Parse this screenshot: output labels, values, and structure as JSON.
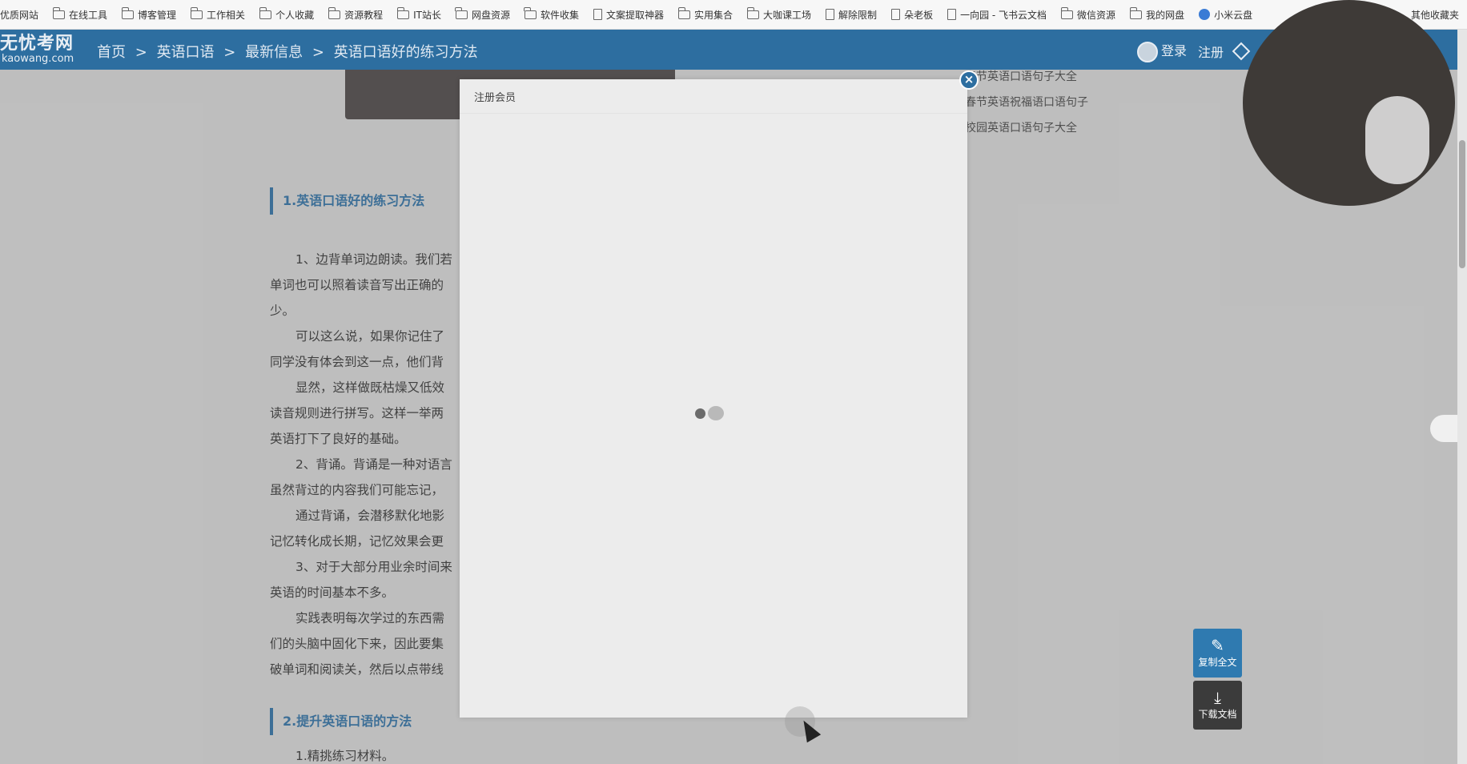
{
  "bookmarks": [
    {
      "label": "优质网站",
      "icon": "folder-icon"
    },
    {
      "label": "在线工具",
      "icon": "folder-icon"
    },
    {
      "label": "博客管理",
      "icon": "folder-icon"
    },
    {
      "label": "工作相关",
      "icon": "folder-icon"
    },
    {
      "label": "个人收藏",
      "icon": "folder-icon"
    },
    {
      "label": "资源教程",
      "icon": "folder-icon"
    },
    {
      "label": "IT站长",
      "icon": "folder-icon"
    },
    {
      "label": "网盘资源",
      "icon": "folder-icon"
    },
    {
      "label": "软件收集",
      "icon": "folder-icon"
    },
    {
      "label": "文案提取神器",
      "icon": "doc-icon"
    },
    {
      "label": "实用集合",
      "icon": "folder-icon"
    },
    {
      "label": "大咖课工场",
      "icon": "folder-icon"
    },
    {
      "label": "解除限制",
      "icon": "doc-icon"
    },
    {
      "label": "朵老板",
      "icon": "doc-icon"
    },
    {
      "label": "一向园 - 飞书云文档",
      "icon": "doc-icon"
    },
    {
      "label": "微信资源",
      "icon": "folder-icon"
    },
    {
      "label": "我的网盘",
      "icon": "folder-icon"
    },
    {
      "label": "小米云盘",
      "icon": "cloud-icon"
    }
  ],
  "bookmarks_other": "其他收藏夹",
  "site": {
    "logo_line1": "无忧考网",
    "logo_line2": "kaowang.com",
    "breadcrumb": [
      "首页",
      ">",
      "英语口语",
      ">",
      "最新信息",
      ">",
      "英语口语好的练习方法"
    ],
    "login": "登录",
    "register": "注册"
  },
  "side_links": [
    "春节英语口语句子大全",
    "春节英语祝福语口语句子",
    "校园英语口语句子大全"
  ],
  "article": {
    "section1_title": "1.英语口语好的练习方法",
    "paragraphs": [
      "1、边背单词边朗读。我们若",
      "单词也可以照着读音写出正确的",
      "少。",
      "可以这么说，如果你记住了",
      "同学没有体会到这一点，他们背",
      "显然，这样做既枯燥又低效",
      "读音规则进行拼写。这样一举两",
      "英语打下了良好的基础。",
      "2、背诵。背诵是一种对语言",
      "虽然背过的内容我们可能忘记，",
      "通过背诵，会潜移默化地影",
      "记忆转化成长期，记忆效果会更",
      "3、对于大部分用业余时间来",
      "英语的时间基本不多。",
      "实践表明每次学过的东西需",
      "们的头脑中固化下来，因此要集",
      "破单词和阅读关，然后以点带线"
    ],
    "section2_title": "2.提升英语口语的方法",
    "section2_first": "1.精挑练习材料。"
  },
  "modal": {
    "title": "注册会员"
  },
  "tools": {
    "copy_label": "复制全文",
    "download_label": "下载文档"
  }
}
